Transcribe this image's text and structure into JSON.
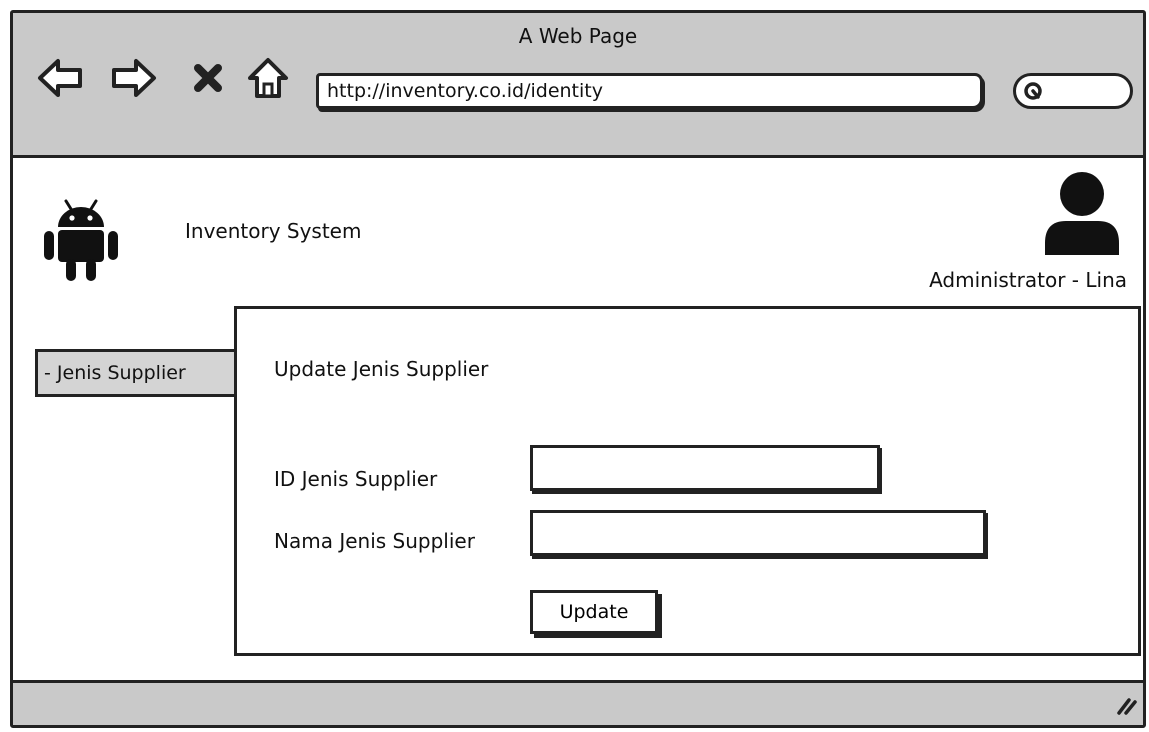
{
  "browser": {
    "title": "A Web Page",
    "url": "http://inventory.co.id/identity",
    "nav_icons": [
      "back-arrow-icon",
      "forward-arrow-icon",
      "close-icon",
      "home-icon"
    ],
    "search_icon": "search-icon"
  },
  "header": {
    "app_title": "Inventory System",
    "logo_icon": "android-icon",
    "user_icon": "user-icon",
    "user_name": "Administrator - Lina"
  },
  "sidebar": {
    "items": [
      {
        "label": "- Jenis Supplier"
      }
    ]
  },
  "form": {
    "heading": "Update Jenis Supplier",
    "fields": [
      {
        "label": "ID Jenis Supplier",
        "value": ""
      },
      {
        "label": "Nama Jenis Supplier",
        "value": ""
      }
    ],
    "submit_label": "Update"
  },
  "colors": {
    "chrome_gray": "#c9c9c9",
    "outline": "#222222",
    "button_gray": "#d4d4d4",
    "background": "#ffffff"
  }
}
